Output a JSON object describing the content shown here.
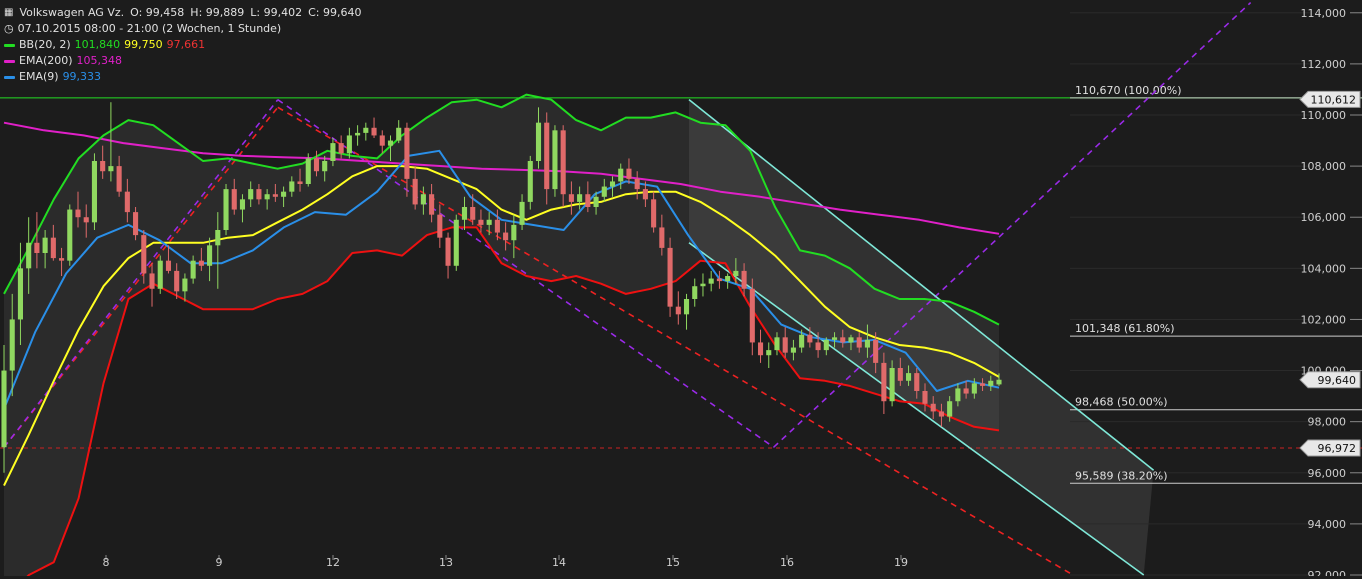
{
  "header": {
    "instrument": "Volkswagen AG Vz.",
    "open_label": "O: 99,458",
    "high_label": "H: 99,889",
    "low_label": "L: 99,402",
    "close_label": "C: 99,640",
    "period": "07.10.2015 08:00 - 21:00 (2 Wochen, 1 Stunde)"
  },
  "indicators": {
    "bb": {
      "label": "BB(20, 2)",
      "upper": "101,840",
      "mid": "99,750",
      "lower": "97,661"
    },
    "ema200": {
      "label": "EMA(200)",
      "value": "105,348"
    },
    "ema9": {
      "label": "EMA(9)",
      "value": "99,333"
    }
  },
  "colors": {
    "background": "#1c1c1c",
    "bb_upper": "#22dd22",
    "bb_mid": "#ffff22",
    "bb_lower": "#ee1111",
    "ema200": "#e020c8",
    "ema9": "#2a8fe8",
    "candle_up": "#90d860",
    "candle_down": "#e06a6a",
    "fib_line": "#cccccc",
    "channel": "#7fe8d8",
    "trend_purple": "#9a2ae8",
    "trend_red": "#ee2222",
    "level_line": "#22dd22"
  },
  "chart_data": {
    "type": "candlestick",
    "title": "Volkswagen AG Vz.",
    "ylim": [
      92000,
      114500
    ],
    "y_ticks": [
      "92,000",
      "94,000",
      "96,000",
      "98,000",
      "100,000",
      "102,000",
      "104,000",
      "106,000",
      "108,000",
      "110,000",
      "112,000",
      "114,000"
    ],
    "x_ticks": [
      "8",
      "9",
      "12",
      "13",
      "14",
      "15",
      "16",
      "19"
    ],
    "price_tags": [
      {
        "label": "110,612",
        "value": 110.612
      },
      {
        "label": "99,640",
        "value": 99.64
      },
      {
        "label": "96,972",
        "value": 96.972
      }
    ],
    "fib_levels": [
      {
        "label": "110,670 (100.00%)",
        "value": 110.67
      },
      {
        "label": "101,348 (61.80%)",
        "value": 101.348
      },
      {
        "label": "98,468 (50.00%)",
        "value": 98.468
      },
      {
        "label": "95,589 (38.20%)",
        "value": 95.589
      }
    ],
    "horizontal_levels": [
      110.67,
      96.972
    ],
    "candles": [
      [
        97,
        101,
        96,
        100
      ],
      [
        100,
        103,
        99,
        102
      ],
      [
        102,
        105,
        101,
        104
      ],
      [
        104,
        106,
        103,
        105
      ],
      [
        105,
        106.2,
        104,
        104.6
      ],
      [
        104.6,
        105.5,
        104,
        105.2
      ],
      [
        105.2,
        105.7,
        104.3,
        104.4
      ],
      [
        104.4,
        104.8,
        103.7,
        104.3
      ],
      [
        104.3,
        106.5,
        104.1,
        106.3
      ],
      [
        106.3,
        107,
        105.6,
        106
      ],
      [
        106,
        106.5,
        105.2,
        105.8
      ],
      [
        105.8,
        108.5,
        105.5,
        108.2
      ],
      [
        108.2,
        108.8,
        107.5,
        107.8
      ],
      [
        107.8,
        110.5,
        107.4,
        108
      ],
      [
        108,
        108.4,
        106.8,
        107
      ],
      [
        107,
        107.5,
        105.8,
        106.2
      ],
      [
        106.2,
        106.4,
        105.1,
        105.3
      ],
      [
        105.3,
        105.5,
        103.4,
        103.8
      ],
      [
        103.8,
        104.2,
        102.5,
        103.2
      ],
      [
        103.2,
        104.5,
        103,
        104.3
      ],
      [
        104.3,
        104.9,
        103.8,
        103.9
      ],
      [
        103.9,
        104.2,
        102.8,
        103.1
      ],
      [
        103.1,
        103.8,
        102.7,
        103.6
      ],
      [
        103.6,
        104.5,
        103.4,
        104.3
      ],
      [
        104.3,
        104.8,
        103.9,
        104.1
      ],
      [
        104.1,
        105.2,
        103.5,
        104.9
      ],
      [
        104.9,
        106.2,
        103.2,
        105.5
      ],
      [
        105.5,
        107.3,
        105.3,
        107.1
      ],
      [
        107.1,
        107.5,
        106.1,
        106.3
      ],
      [
        106.3,
        106.9,
        105.8,
        106.7
      ],
      [
        106.7,
        107.4,
        106.4,
        107.1
      ],
      [
        107.1,
        107.3,
        106.5,
        106.7
      ],
      [
        106.7,
        107.1,
        106.3,
        106.9
      ],
      [
        106.9,
        107.3,
        106.6,
        106.8
      ],
      [
        106.8,
        107.2,
        106.4,
        107
      ],
      [
        107,
        107.6,
        106.8,
        107.4
      ],
      [
        107.4,
        107.9,
        107,
        107.3
      ],
      [
        107.3,
        108.5,
        107.2,
        108.3
      ],
      [
        108.3,
        108.6,
        107.6,
        107.8
      ],
      [
        107.8,
        108.4,
        107.4,
        108.2
      ],
      [
        108.2,
        109.1,
        108,
        108.9
      ],
      [
        108.9,
        109.2,
        108.3,
        108.5
      ],
      [
        108.5,
        109.5,
        108.3,
        109.2
      ],
      [
        109.2,
        109.6,
        108.8,
        109.3
      ],
      [
        109.3,
        109.7,
        109,
        109.5
      ],
      [
        109.5,
        109.9,
        109.1,
        109.2
      ],
      [
        109.2,
        109.4,
        108.5,
        108.8
      ],
      [
        108.8,
        109.2,
        108.2,
        109
      ],
      [
        109,
        109.8,
        108.9,
        109.5
      ],
      [
        109.5,
        109.7,
        106.8,
        107.5
      ],
      [
        107.5,
        108,
        106.3,
        106.5
      ],
      [
        106.5,
        107.2,
        106.1,
        106.9
      ],
      [
        106.9,
        107.3,
        105.8,
        106.1
      ],
      [
        106.1,
        106.5,
        104.8,
        105.2
      ],
      [
        105.2,
        105.4,
        103.6,
        104.1
      ],
      [
        104.1,
        106.1,
        103.9,
        105.9
      ],
      [
        105.9,
        106.8,
        105.5,
        106.4
      ],
      [
        106.4,
        106.9,
        105.7,
        105.9
      ],
      [
        105.9,
        106.3,
        105.4,
        105.7
      ],
      [
        105.7,
        106.2,
        105.3,
        105.9
      ],
      [
        105.9,
        106.3,
        105.1,
        105.4
      ],
      [
        105.4,
        105.8,
        104.7,
        105.1
      ],
      [
        105.1,
        106.1,
        104.4,
        105.7
      ],
      [
        105.7,
        106.9,
        105.5,
        106.6
      ],
      [
        106.6,
        108.4,
        106.3,
        108.2
      ],
      [
        108.2,
        110.3,
        107.9,
        109.7
      ],
      [
        109.7,
        110.1,
        106.5,
        107.1
      ],
      [
        107.1,
        109.6,
        106.8,
        109.4
      ],
      [
        109.4,
        109.6,
        106.4,
        106.9
      ],
      [
        106.9,
        107.4,
        106.1,
        106.6
      ],
      [
        106.6,
        107.2,
        106.3,
        106.9
      ],
      [
        106.9,
        107.4,
        106.2,
        106.4
      ],
      [
        106.4,
        107,
        106.1,
        106.8
      ],
      [
        106.8,
        107.5,
        106.6,
        107.2
      ],
      [
        107.2,
        107.6,
        106.8,
        107.4
      ],
      [
        107.4,
        108.1,
        107.1,
        107.9
      ],
      [
        107.9,
        108.3,
        107.3,
        107.5
      ],
      [
        107.5,
        107.8,
        106.7,
        107.1
      ],
      [
        107.1,
        107.4,
        106.4,
        106.7
      ],
      [
        106.7,
        107,
        105.4,
        105.6
      ],
      [
        105.6,
        106.1,
        104.5,
        104.8
      ],
      [
        104.8,
        105.2,
        102.1,
        102.5
      ],
      [
        102.5,
        103.1,
        101.8,
        102.2
      ],
      [
        102.2,
        103,
        101.6,
        102.8
      ],
      [
        102.8,
        103.6,
        102.5,
        103.3
      ],
      [
        103.3,
        103.8,
        102.9,
        103.4
      ],
      [
        103.4,
        103.9,
        103.1,
        103.6
      ],
      [
        103.6,
        103.9,
        103.2,
        103.5
      ],
      [
        103.5,
        103.8,
        103.2,
        103.7
      ],
      [
        103.7,
        104.4,
        103.4,
        103.9
      ],
      [
        103.9,
        104.2,
        102.9,
        103.2
      ],
      [
        103.2,
        103.6,
        100.6,
        101.1
      ],
      [
        101.1,
        101.6,
        100.3,
        100.6
      ],
      [
        100.6,
        101.1,
        100.1,
        100.8
      ],
      [
        100.8,
        101.5,
        100.6,
        101.3
      ],
      [
        101.3,
        101.7,
        100.5,
        100.7
      ],
      [
        100.7,
        101.2,
        100.4,
        100.9
      ],
      [
        100.9,
        101.6,
        100.7,
        101.4
      ],
      [
        101.4,
        101.7,
        100.9,
        101.1
      ],
      [
        101.1,
        101.5,
        100.5,
        100.8
      ],
      [
        100.8,
        101.3,
        100.6,
        101.2
      ],
      [
        101.2,
        101.5,
        100.9,
        101.3
      ],
      [
        101.3,
        101.6,
        100.9,
        101.1
      ],
      [
        101.1,
        101.4,
        100.8,
        101.3
      ],
      [
        101.3,
        101.5,
        100.7,
        100.9
      ],
      [
        100.9,
        101.8,
        100.5,
        101.2
      ],
      [
        101.2,
        101.5,
        99.9,
        100.3
      ],
      [
        100.3,
        100.7,
        98.3,
        98.8
      ],
      [
        98.8,
        100.4,
        98.6,
        100.1
      ],
      [
        100.1,
        100.5,
        99.4,
        99.6
      ],
      [
        99.6,
        100.2,
        99.4,
        99.9
      ],
      [
        99.9,
        100.1,
        98.9,
        99.2
      ],
      [
        99.2,
        99.5,
        98.4,
        98.7
      ],
      [
        98.7,
        99,
        98.1,
        98.4
      ],
      [
        98.4,
        98.7,
        97.8,
        98.2
      ],
      [
        98.2,
        99,
        98,
        98.8
      ],
      [
        98.8,
        99.5,
        98.6,
        99.3
      ],
      [
        99.3,
        99.6,
        98.9,
        99.1
      ],
      [
        99.1,
        99.7,
        98.9,
        99.5
      ],
      [
        99.5,
        99.7,
        99.2,
        99.4
      ],
      [
        99.4,
        99.8,
        99.2,
        99.6
      ],
      [
        99.458,
        99.889,
        99.402,
        99.64
      ]
    ],
    "series": [
      {
        "name": "BB(20, 2)",
        "role": "upper",
        "values": [
          103,
          104.8,
          106.7,
          108.3,
          109.2,
          109.8,
          109.6,
          108.9,
          108.2,
          108.3,
          108.1,
          107.9,
          108.1,
          108.6,
          108.4,
          108.3,
          109.2,
          109.9,
          110.5,
          110.6,
          110.3,
          110.8,
          110.6,
          109.8,
          109.4,
          109.9,
          109.9,
          110.1,
          109.7,
          109.6,
          108.6,
          106.4,
          104.7,
          104.5,
          104,
          103.2,
          102.8,
          102.8,
          102.7,
          102.3,
          101.8
        ]
      },
      {
        "name": "BB(20, 2)",
        "role": "mid",
        "values": [
          95.5,
          97.5,
          99.6,
          101.6,
          103.3,
          104.4,
          105,
          105,
          105,
          105.2,
          105.3,
          105.8,
          106.3,
          106.9,
          107.6,
          108,
          108,
          107.9,
          107.5,
          107.1,
          106.3,
          105.9,
          106.3,
          106.5,
          106.6,
          106.9,
          107,
          107,
          106.6,
          106,
          105.3,
          104.5,
          103.5,
          102.5,
          101.7,
          101.3,
          101,
          100.9,
          100.7,
          100.3,
          99.75
        ]
      },
      {
        "name": "BB(20, 2)",
        "role": "lower",
        "values": [
          91,
          92,
          92.5,
          95,
          99.5,
          102.8,
          103.4,
          102.9,
          102.4,
          102.4,
          102.4,
          102.8,
          103,
          103.5,
          104.6,
          104.7,
          104.5,
          105.3,
          105.6,
          105.6,
          104.2,
          103.7,
          103.5,
          103.7,
          103.4,
          103,
          103.2,
          103.5,
          104.3,
          104.2,
          102.5,
          101,
          99.7,
          99.6,
          99.4,
          99.1,
          98.8,
          98.7,
          98.2,
          97.8,
          97.66
        ]
      },
      {
        "name": "EMA(200)",
        "values": [
          109.7,
          109.4,
          109.2,
          108.9,
          108.7,
          108.5,
          108.4,
          108.35,
          108.3,
          108.2,
          108.1,
          108.0,
          107.9,
          107.85,
          107.8,
          107.7,
          107.5,
          107.3,
          107.0,
          106.8,
          106.55,
          106.3,
          106.1,
          105.9,
          105.6,
          105.35
        ]
      },
      {
        "name": "EMA(9)",
        "values": [
          98.5,
          101.5,
          103.8,
          105.2,
          105.7,
          105.1,
          104.2,
          104.2,
          104.7,
          105.6,
          106.2,
          106.1,
          107.0,
          108.4,
          108.6,
          106.8,
          105.9,
          105.7,
          105.5,
          106.9,
          107.4,
          107.2,
          105.3,
          103.6,
          103.2,
          101.8,
          101.3,
          101.1,
          101.2,
          100.7,
          99.2,
          99.6,
          99.33
        ]
      }
    ],
    "drawings": {
      "purple_dashed": [
        [
          [
            0,
            97
          ],
          [
            33.3,
            110.6
          ]
        ],
        [
          [
            33.3,
            110.6
          ],
          [
            93.6,
            97
          ]
        ],
        [
          [
            93.6,
            97
          ],
          [
            151.6,
            114.4
          ]
        ]
      ],
      "red_dashed": [
        [
          [
            0,
            97
          ],
          [
            33.3,
            110.3
          ]
        ],
        [
          [
            33.3,
            110.3
          ],
          [
            130,
            92
          ]
        ]
      ],
      "channel": [
        [
          [
            83.3,
            110.6
          ],
          [
            139.8,
            96.1
          ]
        ],
        [
          [
            83.3,
            105
          ],
          [
            138.6,
            92
          ]
        ]
      ]
    },
    "grid": false,
    "legend": "top-left"
  }
}
